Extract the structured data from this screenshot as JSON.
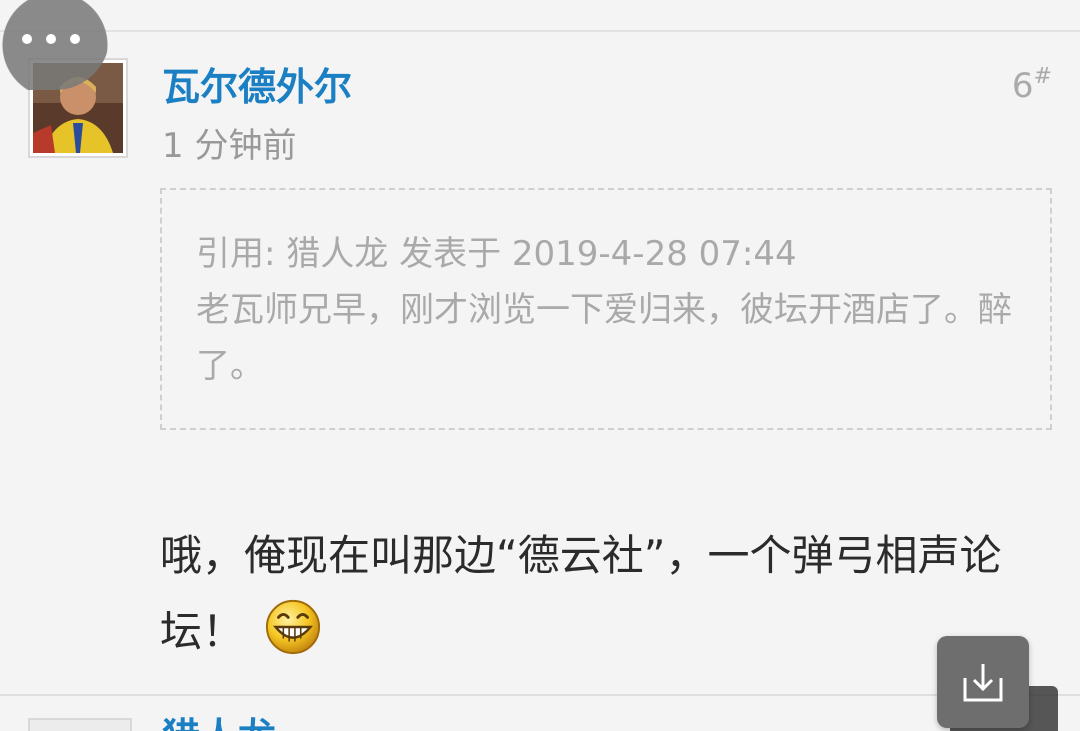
{
  "post": {
    "username": "瓦尔德外尔",
    "time": "1 分钟前",
    "floor_number": "6",
    "floor_symbol": "#",
    "quote": {
      "header": "引用: 猎人龙 发表于 2019-4-28 07:44",
      "body": "老瓦师兄早，刚才浏览一下爱归来，彼坛开酒店了。醉了。"
    },
    "reply_text": "哦，俺现在叫那边“德云社”，一个弹弓相声论坛！",
    "emoji_icon": "grinning-face-icon"
  },
  "next_post": {
    "username": "猎人龙"
  },
  "colors": {
    "username": "#1b7fc4",
    "muted": "#999999",
    "body_text": "#2b2b2b",
    "background": "#f4f4f4"
  }
}
